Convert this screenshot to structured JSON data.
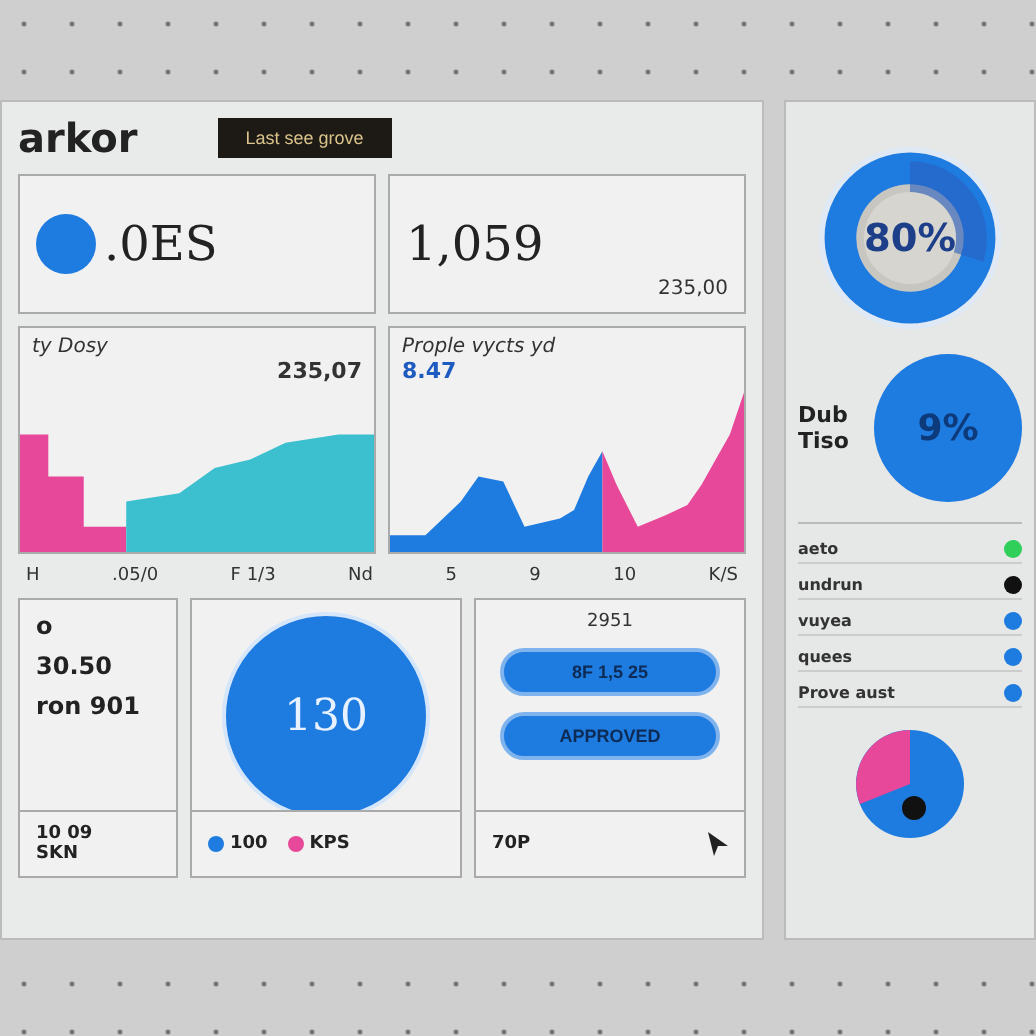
{
  "header": {
    "title": "arkor",
    "button": "Last see grove"
  },
  "stats": [
    {
      "value": ".0ES",
      "kind": "dot"
    },
    {
      "value": "1,059",
      "sub": "235,00",
      "kind": "plain"
    }
  ],
  "charts": [
    {
      "label": "ty Dosy",
      "value": "235,07",
      "kind": "left"
    },
    {
      "label": "Prople vycts yd",
      "value": "8.47",
      "kind": "right"
    }
  ],
  "axis_labels": [
    "H",
    ".05/0",
    "F 1/3",
    "Nd",
    "5",
    "9",
    "10",
    "K/S"
  ],
  "summary": {
    "heading": "o",
    "lines": [
      "30.50",
      "ron 901"
    ]
  },
  "center": {
    "value": "130"
  },
  "actions": {
    "label": "2951",
    "buttons": [
      "8F 1,5 25",
      "APPROVED"
    ]
  },
  "footer": {
    "left": [
      "10 09",
      "SKN"
    ],
    "legend": [
      {
        "label": "100",
        "color": "#1e7be0"
      },
      {
        "label": "KPS",
        "color": "#e8489a"
      }
    ],
    "right": "70P"
  },
  "side": {
    "donut": {
      "value": "80%"
    },
    "gauge": {
      "label": "Dub Tiso",
      "value": "9%"
    },
    "rows": [
      {
        "label": "aeto",
        "color": "#2fcf5a"
      },
      {
        "label": "undrun",
        "color": "#111111"
      },
      {
        "label": "vuyea",
        "color": "#1e7be0"
      },
      {
        "label": "quees",
        "color": "#1e7be0"
      },
      {
        "label": "Prove aust",
        "color": "#1e7be0"
      }
    ]
  }
}
